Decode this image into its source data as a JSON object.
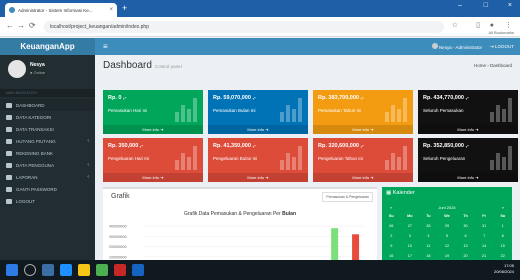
{
  "browser": {
    "tab_title": "Administrator - Sistem Informasi Ke...",
    "url": "localhost/project_keuangan/admin/index.php",
    "bookmarks_label": "All Bookmarks"
  },
  "app": {
    "logo": "KeuanganApp",
    "top_user": "Nesya - Administrator",
    "logout": "LOGOUT"
  },
  "sidebar": {
    "user_name": "Nesya",
    "user_status": "● Online",
    "header": "MAIN NAVIGATION",
    "items": [
      {
        "label": "DASHBOARD",
        "chevron": false
      },
      {
        "label": "DATA KATEGORI",
        "chevron": false
      },
      {
        "label": "DATA TRANSAKSI",
        "chevron": false
      },
      {
        "label": "HUTANG PIUTANG",
        "chevron": true
      },
      {
        "label": "REKENING BANK",
        "chevron": false
      },
      {
        "label": "DATA PENGGUNA",
        "chevron": true
      },
      {
        "label": "LAPORAN",
        "chevron": true
      },
      {
        "label": "GANTI PASSWORD",
        "chevron": false
      },
      {
        "label": "LOGOUT",
        "chevron": false
      }
    ]
  },
  "page": {
    "title": "Dashboard",
    "subtitle": "Control panel",
    "breadcrumb": "Home › Dashboard"
  },
  "stats": [
    {
      "value": "Rp. 0 ,-",
      "label": "Pemasukan Hari Ini",
      "more": "More info",
      "color": "#00a65a"
    },
    {
      "value": "Rp. 59,070,000 ,-",
      "label": "Pemasukan Bulan Ini",
      "more": "More info",
      "color": "#0073b7"
    },
    {
      "value": "Rp. 383,700,000 ,-",
      "label": "Pemasukan Tahun Ini",
      "more": "More info",
      "color": "#f39c12"
    },
    {
      "value": "Rp. 434,770,000 ,-",
      "label": "Seluruh Pemasukan",
      "more": "More info",
      "color": "#111111"
    },
    {
      "value": "Rp. 350,000 ,-",
      "label": "Pengeluaran Hari Ini",
      "more": "More info",
      "color": "#dd4b39"
    },
    {
      "value": "Rp. 41,350,000 ,-",
      "label": "Pengeluaran Bulan Ini",
      "more": "More info",
      "color": "#dd4b39"
    },
    {
      "value": "Rp. 320,600,000 ,-",
      "label": "Pengeluaran Tahun Ini",
      "more": "More info",
      "color": "#dd4b39"
    },
    {
      "value": "Rp. 352,850,000 ,-",
      "label": "Seluruh Pengeluaran",
      "more": "More info",
      "color": "#111111"
    }
  ],
  "grafik": {
    "title": "Grafik",
    "tab": "Pemasukan & Pengeluaran",
    "chart_title": "Grafik Data Pemasukan & Pengeluaran Per",
    "chart_title_bold": "Bulan"
  },
  "chart_data": {
    "type": "bar",
    "title": "Grafik Data Pemasukan & Pengeluaran Per Bulan",
    "yticks": [
      "400000000",
      "300000000",
      "200000000",
      "100000000"
    ],
    "series": [
      {
        "name": "Pemasukan",
        "color": "#7be07b",
        "values": [
          0,
          0,
          0,
          0,
          0,
          0,
          0,
          0,
          0,
          0,
          0,
          380000000,
          0
        ]
      },
      {
        "name": "Pengeluaran",
        "color": "#e74c3c",
        "values": [
          0,
          0,
          0,
          0,
          0,
          0,
          0,
          0,
          0,
          0,
          0,
          0,
          320000000
        ]
      }
    ],
    "ylim": [
      0,
      450000000
    ]
  },
  "calendar": {
    "title": "Kalender",
    "month": "Juni 2024",
    "prev": "«",
    "next": "»",
    "days": [
      "Su",
      "Mo",
      "Tu",
      "We",
      "Th",
      "Fr",
      "Sa"
    ],
    "dates": [
      "26",
      "27",
      "28",
      "29",
      "30",
      "31",
      "1",
      "2",
      "3",
      "4",
      "5",
      "6",
      "7",
      "8",
      "9",
      "10",
      "11",
      "12",
      "13",
      "14",
      "15",
      "16",
      "17",
      "18",
      "19",
      "20",
      "21",
      "22"
    ]
  },
  "taskbar": {
    "time": "17:05",
    "date": "20/06/2024"
  }
}
